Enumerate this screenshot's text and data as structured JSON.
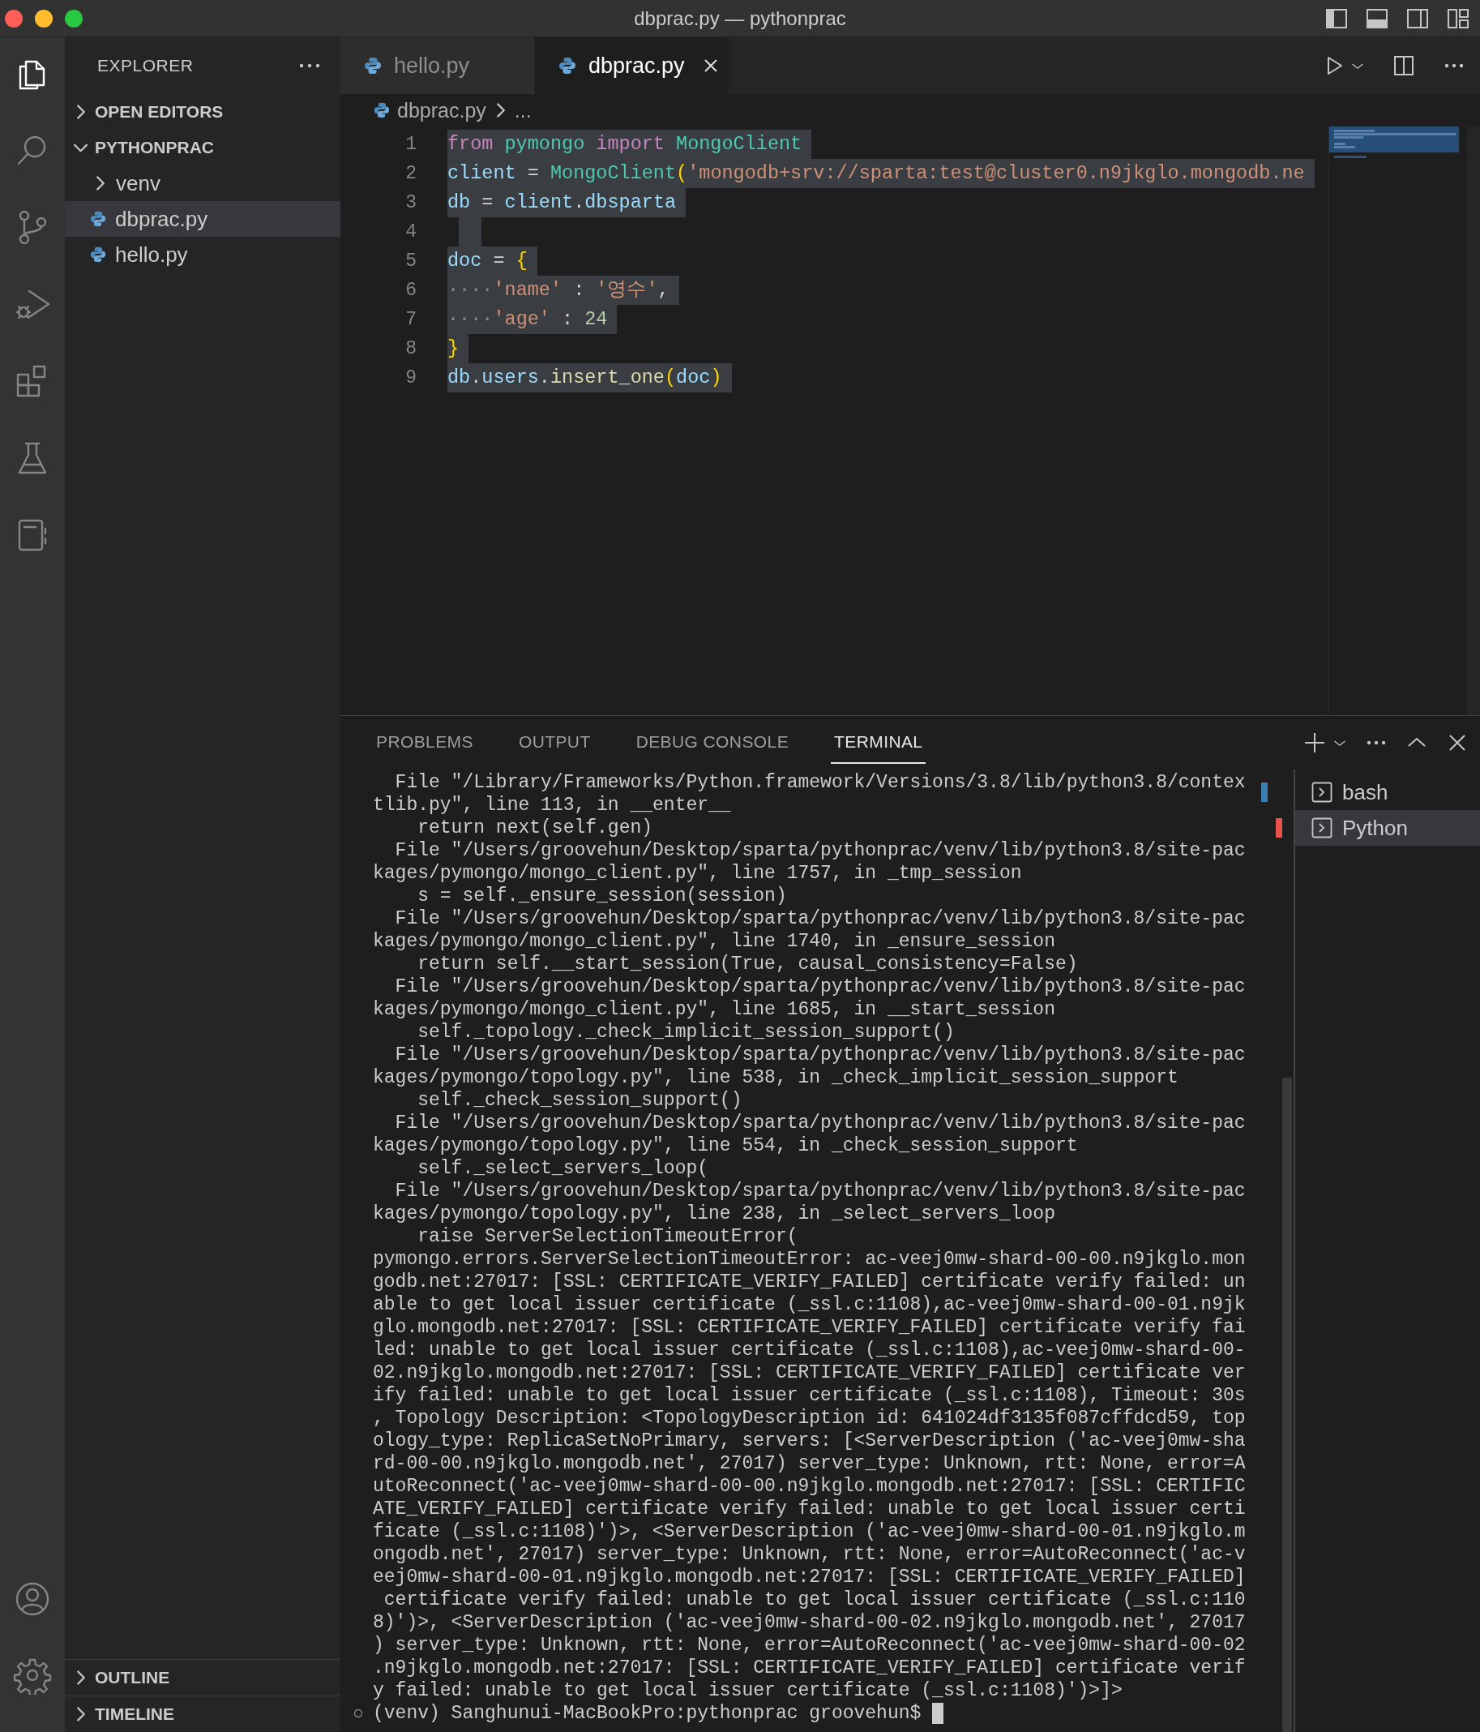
{
  "window": {
    "title": "dbprac.py — pythonprac"
  },
  "activity_bar": {
    "items": [
      {
        "kind": "explorer",
        "selected": true
      },
      {
        "kind": "search",
        "selected": false
      },
      {
        "kind": "source_control",
        "selected": false
      },
      {
        "kind": "run",
        "selected": false
      },
      {
        "kind": "extensions",
        "selected": false
      },
      {
        "kind": "testing",
        "selected": false
      },
      {
        "kind": "notebook",
        "selected": false
      }
    ],
    "bottom": [
      {
        "kind": "account"
      },
      {
        "kind": "settings"
      }
    ]
  },
  "sidebar": {
    "title": "EXPLORER",
    "sections": [
      {
        "label": "OPEN EDITORS",
        "expanded": false
      },
      {
        "label": "PYTHONPRAC",
        "expanded": true,
        "children": [
          {
            "label": "venv",
            "kind": "folder",
            "expanded": false,
            "selected": false
          },
          {
            "label": "dbprac.py",
            "kind": "python",
            "selected": true
          },
          {
            "label": "hello.py",
            "kind": "python",
            "selected": false
          }
        ]
      }
    ],
    "bottom_sections": [
      {
        "label": "OUTLINE",
        "expanded": false
      },
      {
        "label": "TIMELINE",
        "expanded": false
      }
    ]
  },
  "tabs": [
    {
      "label": "hello.py",
      "selected": false
    },
    {
      "label": "dbprac.py",
      "selected": true
    }
  ],
  "breadcrumb": {
    "file": "dbprac.py",
    "rest": "..."
  },
  "editor": {
    "lines": [
      {
        "number": "1",
        "tokens": [
          {
            "text": "from ",
            "kind": "keyword"
          },
          {
            "text": "pymongo ",
            "kind": "module"
          },
          {
            "text": "import ",
            "kind": "keyword"
          },
          {
            "text": "MongoClient",
            "kind": "class"
          }
        ]
      },
      {
        "number": "2",
        "tokens": [
          {
            "text": "client",
            "kind": "variable"
          },
          {
            "text": " = ",
            "kind": "plain"
          },
          {
            "text": "MongoClient",
            "kind": "class"
          },
          {
            "text": "(",
            "kind": "bracket"
          },
          {
            "text": "'mongodb+srv://sparta:test@cluster0.n9jkglo.mongodb.ne",
            "kind": "string"
          }
        ]
      },
      {
        "number": "3",
        "tokens": [
          {
            "text": "db",
            "kind": "variable"
          },
          {
            "text": " = ",
            "kind": "plain"
          },
          {
            "text": "client",
            "kind": "variable"
          },
          {
            "text": ".",
            "kind": "plain"
          },
          {
            "text": "dbsparta",
            "kind": "variable"
          }
        ]
      },
      {
        "number": "4"
      },
      {
        "number": "5",
        "tokens": [
          {
            "text": "doc",
            "kind": "variable"
          },
          {
            "text": " = ",
            "kind": "plain"
          },
          {
            "text": "{",
            "kind": "bracket"
          }
        ]
      },
      {
        "number": "6",
        "tokens": [
          {
            "text": "····",
            "kind": "whitespace"
          },
          {
            "text": "'name'",
            "kind": "string"
          },
          {
            "text": " : ",
            "kind": "plain"
          },
          {
            "text": "'영수'",
            "kind": "string"
          },
          {
            "text": ",",
            "kind": "plain"
          }
        ]
      },
      {
        "number": "7",
        "tokens": [
          {
            "text": "····",
            "kind": "whitespace"
          },
          {
            "text": "'age'",
            "kind": "string"
          },
          {
            "text": " : ",
            "kind": "plain"
          },
          {
            "text": "24",
            "kind": "number"
          }
        ]
      },
      {
        "number": "8",
        "tokens": [
          {
            "text": "}",
            "kind": "bracket"
          }
        ]
      },
      {
        "number": "9",
        "tokens": [
          {
            "text": "db",
            "kind": "variable"
          },
          {
            "text": ".",
            "kind": "plain"
          },
          {
            "text": "users",
            "kind": "variable"
          },
          {
            "text": ".",
            "kind": "plain"
          },
          {
            "text": "insert_one",
            "kind": "function"
          },
          {
            "text": "(",
            "kind": "bracket"
          },
          {
            "text": "doc",
            "kind": "variable"
          },
          {
            "text": ")",
            "kind": "bracket"
          }
        ]
      }
    ]
  },
  "panel": {
    "tabs": [
      {
        "label": "PROBLEMS",
        "selected": false
      },
      {
        "label": "OUTPUT",
        "selected": false
      },
      {
        "label": "DEBUG CONSOLE",
        "selected": false
      },
      {
        "label": "TERMINAL",
        "selected": true
      }
    ],
    "terminal": {
      "lines": [
        "  File \"/Library/Frameworks/Python.framework/Versions/3.8/lib/python3.8/contex",
        "tlib.py\", line 113, in __enter__",
        "    return next(self.gen)",
        "  File \"/Users/groovehun/Desktop/sparta/pythonprac/venv/lib/python3.8/site-pac",
        "kages/pymongo/mongo_client.py\", line 1757, in _tmp_session",
        "    s = self._ensure_session(session)",
        "  File \"/Users/groovehun/Desktop/sparta/pythonprac/venv/lib/python3.8/site-pac",
        "kages/pymongo/mongo_client.py\", line 1740, in _ensure_session",
        "    return self.__start_session(True, causal_consistency=False)",
        "  File \"/Users/groovehun/Desktop/sparta/pythonprac/venv/lib/python3.8/site-pac",
        "kages/pymongo/mongo_client.py\", line 1685, in __start_session",
        "    self._topology._check_implicit_session_support()",
        "  File \"/Users/groovehun/Desktop/sparta/pythonprac/venv/lib/python3.8/site-pac",
        "kages/pymongo/topology.py\", line 538, in _check_implicit_session_support",
        "    self._check_session_support()",
        "  File \"/Users/groovehun/Desktop/sparta/pythonprac/venv/lib/python3.8/site-pac",
        "kages/pymongo/topology.py\", line 554, in _check_session_support",
        "    self._select_servers_loop(",
        "  File \"/Users/groovehun/Desktop/sparta/pythonprac/venv/lib/python3.8/site-pac",
        "kages/pymongo/topology.py\", line 238, in _select_servers_loop",
        "    raise ServerSelectionTimeoutError(",
        "pymongo.errors.ServerSelectionTimeoutError: ac-veej0mw-shard-00-00.n9jkglo.mon",
        "godb.net:27017: [SSL: CERTIFICATE_VERIFY_FAILED] certificate verify failed: un",
        "able to get local issuer certificate (_ssl.c:1108),ac-veej0mw-shard-00-01.n9jk",
        "glo.mongodb.net:27017: [SSL: CERTIFICATE_VERIFY_FAILED] certificate verify fai",
        "led: unable to get local issuer certificate (_ssl.c:1108),ac-veej0mw-shard-00-",
        "02.n9jkglo.mongodb.net:27017: [SSL: CERTIFICATE_VERIFY_FAILED] certificate ver",
        "ify failed: unable to get local issuer certificate (_ssl.c:1108), Timeout: 30s",
        ", Topology Description: <TopologyDescription id: 641024df3135f087cffdcd59, top",
        "ology_type: ReplicaSetNoPrimary, servers: [<ServerDescription ('ac-veej0mw-sha",
        "rd-00-00.n9jkglo.mongodb.net', 27017) server_type: Unknown, rtt: None, error=A",
        "utoReconnect('ac-veej0mw-shard-00-00.n9jkglo.mongodb.net:27017: [SSL: CERTIFIC",
        "ATE_VERIFY_FAILED] certificate verify failed: unable to get local issuer certi",
        "ficate (_ssl.c:1108)')>, <ServerDescription ('ac-veej0mw-shard-00-01.n9jkglo.m",
        "ongodb.net', 27017) server_type: Unknown, rtt: None, error=AutoReconnect('ac-v",
        "eej0mw-shard-00-01.n9jkglo.mongodb.net:27017: [SSL: CERTIFICATE_VERIFY_FAILED]",
        " certificate verify failed: unable to get local issuer certificate (_ssl.c:110",
        "8)')>, <ServerDescription ('ac-veej0mw-shard-00-02.n9jkglo.mongodb.net', 27017",
        ") server_type: Unknown, rtt: None, error=AutoReconnect('ac-veej0mw-shard-00-02",
        ".n9jkglo.mongodb.net:27017: [SSL: CERTIFICATE_VERIFY_FAILED] certificate verif",
        "y failed: unable to get local issuer certificate (_ssl.c:1108)')>]>"
      ],
      "prompt": "(venv) Sanghunui-MacBookPro:pythonprac groovehun$"
    },
    "terminals": [
      {
        "label": "bash",
        "color": "#3a7fb0",
        "selected": false
      },
      {
        "label": "Python",
        "color": "#e5534b",
        "selected": true
      }
    ]
  }
}
